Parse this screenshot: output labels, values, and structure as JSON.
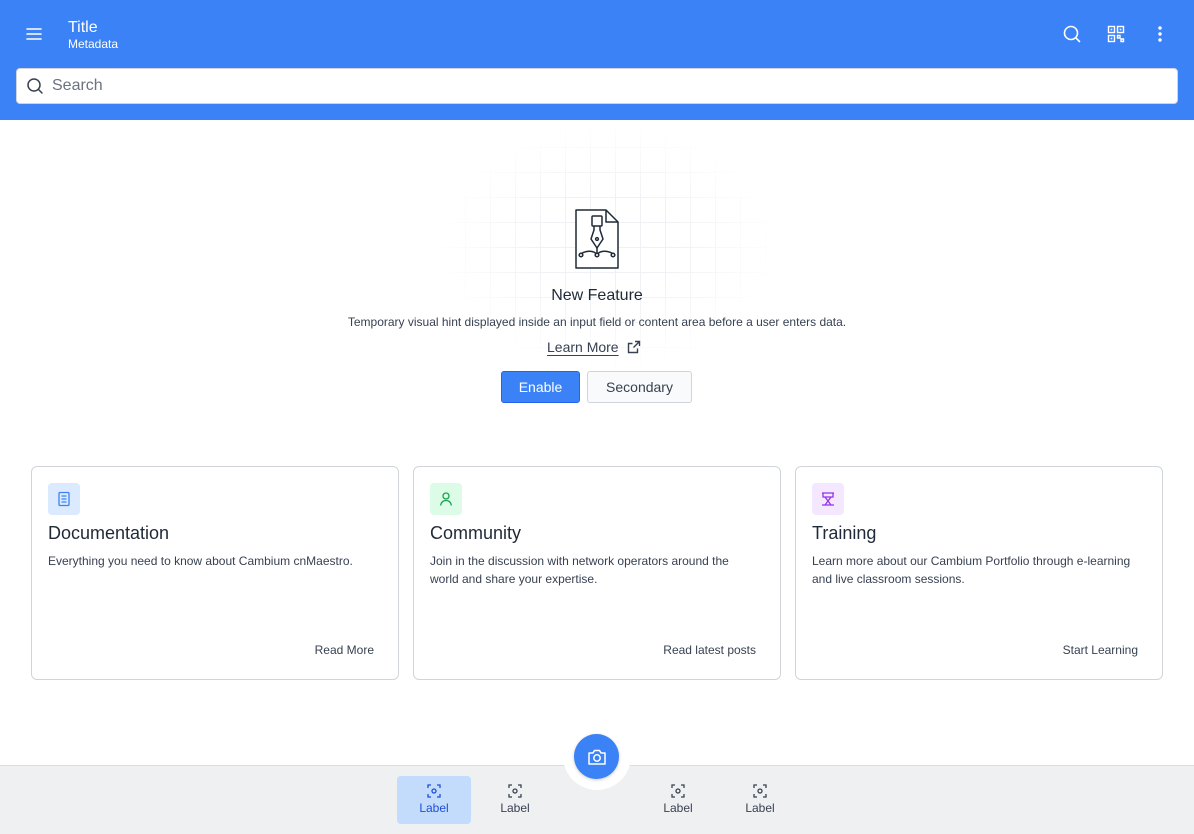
{
  "header": {
    "title": "Title",
    "metadata": "Metadata",
    "menu_icon": "hamburger-menu-icon",
    "search_icon": "search-icon",
    "qr_icon": "qr-code-icon",
    "more_icon": "more-vertical-icon",
    "background_color": "#3b82f6"
  },
  "search": {
    "placeholder": "Search",
    "value": ""
  },
  "hero": {
    "illustration": "document-pen-icon",
    "title": "New Feature",
    "description": "Temporary visual hint displayed inside an input field or content area before a user enters data.",
    "learn_more": "Learn More",
    "learn_more_icon": "external-link-icon",
    "primary_button": "Enable",
    "secondary_button": "Secondary"
  },
  "cards": [
    {
      "icon": "document-icon",
      "icon_color": "#3b82f6",
      "icon_bg": "#dbeafe",
      "title": "Documentation",
      "description": "Everything you need to know about Cambium cnMaestro.",
      "link": "Read More"
    },
    {
      "icon": "user-icon",
      "icon_color": "#16a34a",
      "icon_bg": "#dcfce7",
      "title": "Community",
      "description": "Join in the discussion with network operators around the world and share your expertise.",
      "link": "Read latest posts"
    },
    {
      "icon": "training-icon",
      "icon_color": "#9333ea",
      "icon_bg": "#f3e8ff",
      "title": "Training",
      "description": "Learn more about our Cambium Portfolio through e-learning and live classroom sessions.",
      "link": "Start Learning"
    }
  ],
  "bottom_nav": {
    "fab_icon": "camera-icon",
    "items": [
      {
        "label": "Label",
        "icon": "focus-icon",
        "active": true
      },
      {
        "label": "Label",
        "icon": "focus-icon",
        "active": false
      },
      {
        "label": "Label",
        "icon": "focus-icon",
        "active": false
      },
      {
        "label": "Label",
        "icon": "focus-icon",
        "active": false
      }
    ]
  }
}
